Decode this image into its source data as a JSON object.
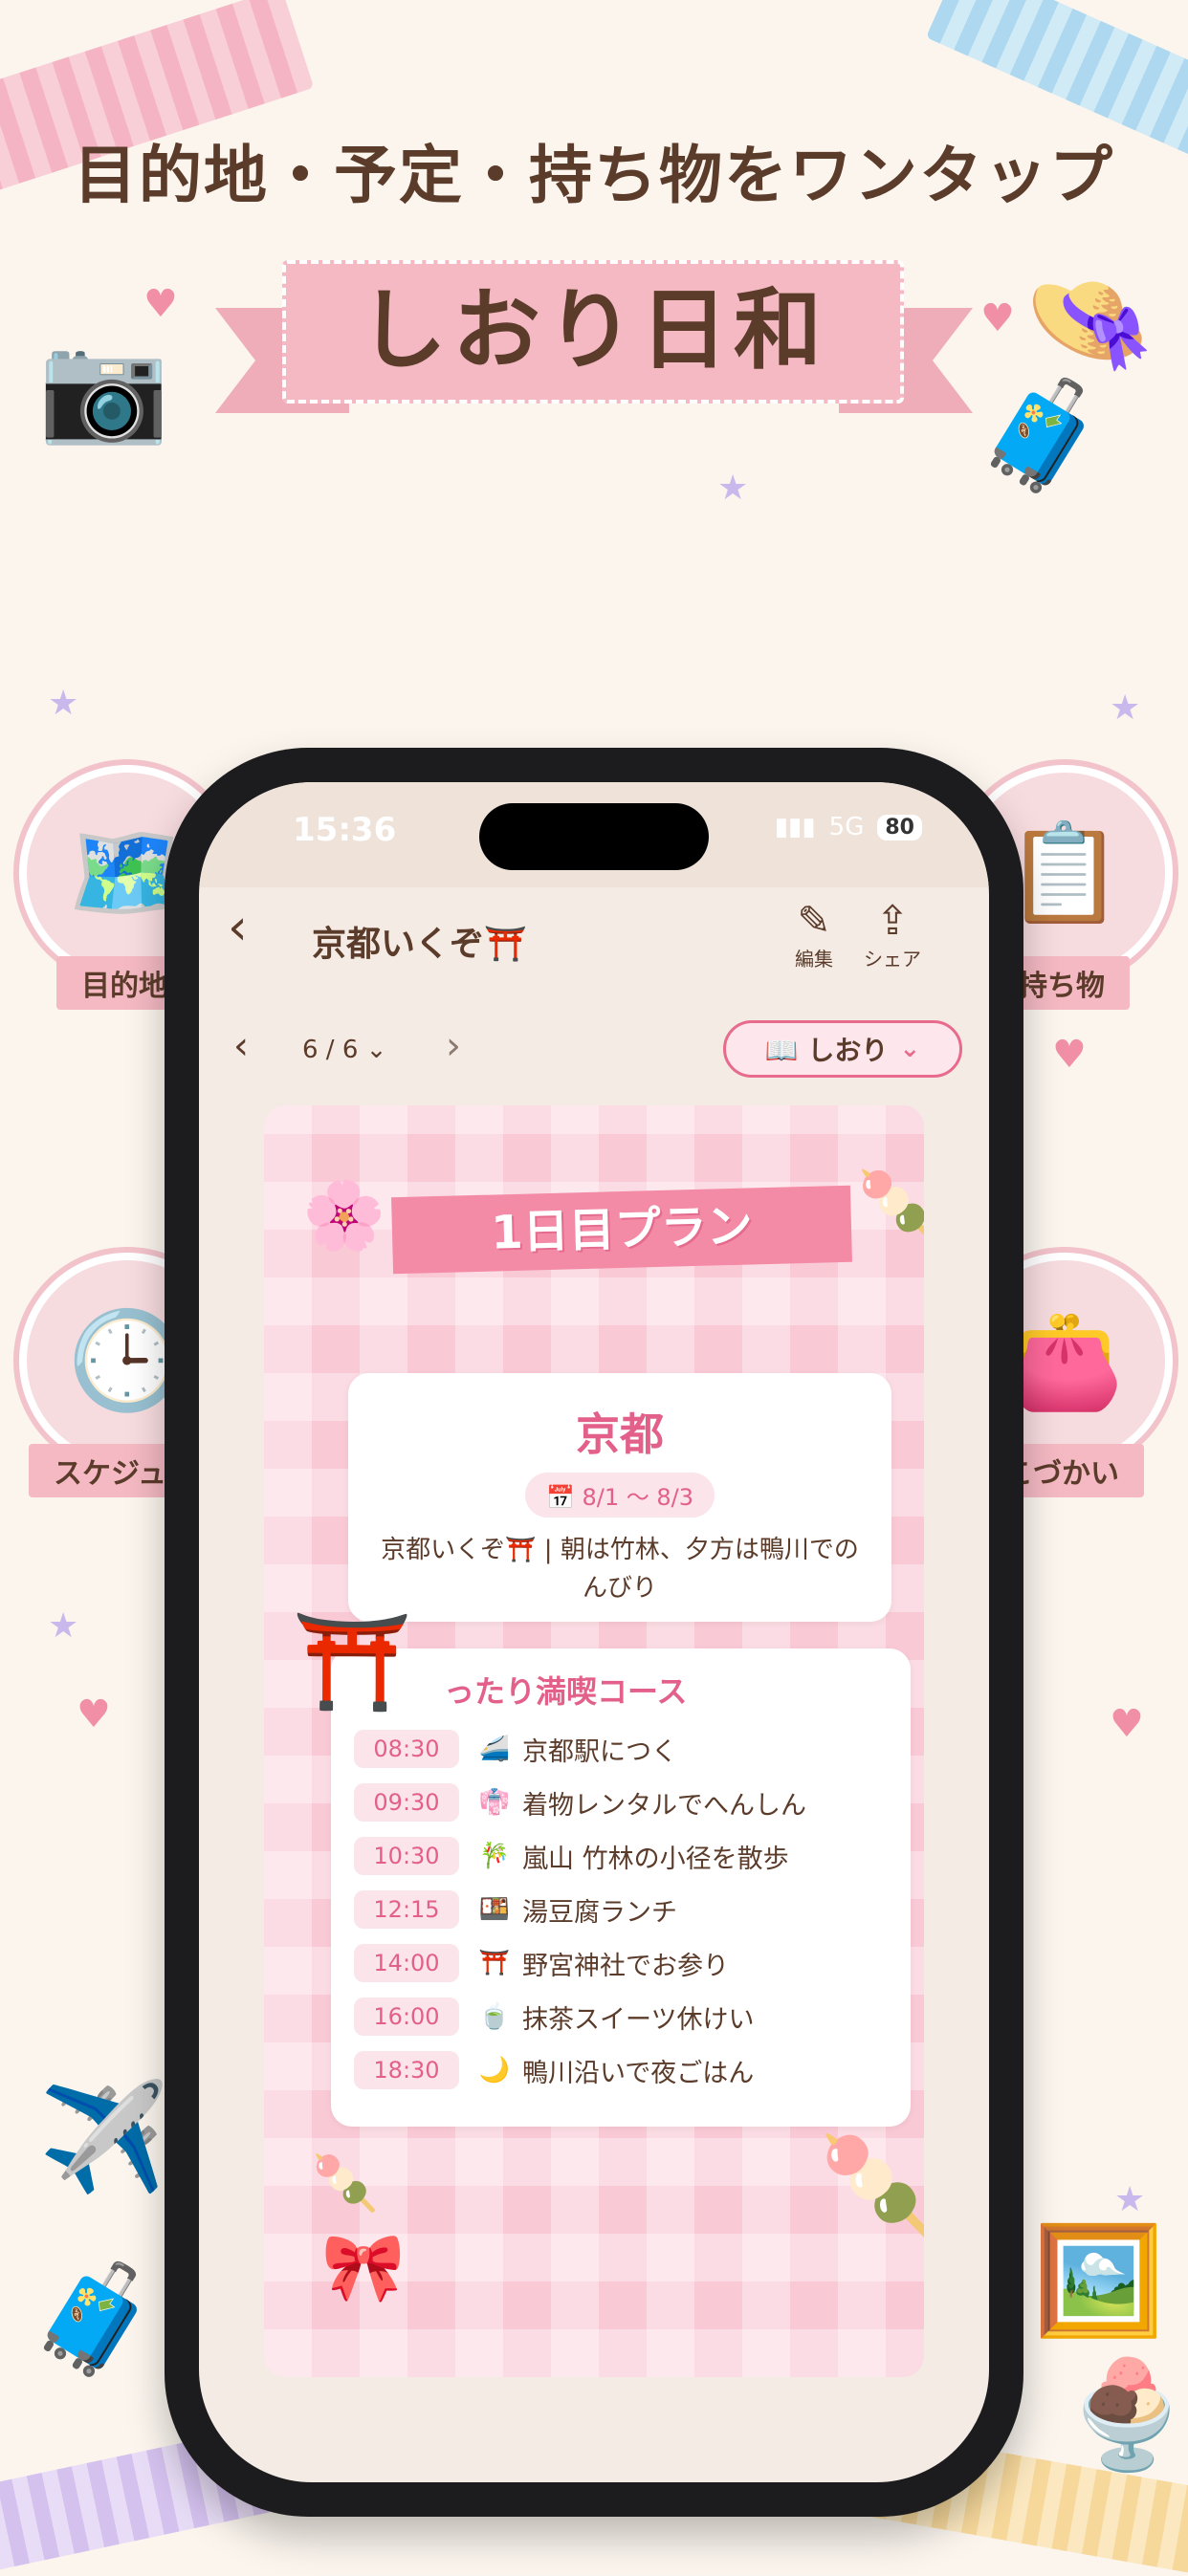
{
  "promo": {
    "headline": "目的地・予定・持ち物をワンタップ",
    "app_name": "しおり日和",
    "features": [
      "目的地",
      "持ち物",
      "スケジュー",
      "こづかい"
    ]
  },
  "status_bar": {
    "time": "15:36",
    "network": "5G",
    "battery": "80"
  },
  "nav": {
    "title": "京都いくぞ⛩️",
    "edit_label": "編集",
    "share_label": "シェア"
  },
  "pager": {
    "label": "6 / 6 ⌄",
    "mode_label": "📖 しおり"
  },
  "plan": {
    "page_title": "1日目プラン",
    "city": "京都",
    "dates": "📅 8/1 〜 8/3",
    "memo": "京都いくぞ⛩️ | 朝は竹林、夕方は鴨川でのんびり",
    "course_title": "ったり満喫コース",
    "schedule": [
      {
        "time": "08:30",
        "icon": "🚄",
        "text": "京都駅につく"
      },
      {
        "time": "09:30",
        "icon": "👘",
        "text": "着物レンタルでへんしん"
      },
      {
        "time": "10:30",
        "icon": "🎋",
        "text": "嵐山 竹林の小径を散歩"
      },
      {
        "time": "12:15",
        "icon": "🍱",
        "text": "湯豆腐ランチ"
      },
      {
        "time": "14:00",
        "icon": "⛩️",
        "text": "野宮神社でお参り"
      },
      {
        "time": "16:00",
        "icon": "🍵",
        "text": "抹茶スイーツ休けい"
      },
      {
        "time": "18:30",
        "icon": "🌙",
        "text": "鴨川沿いで夜ごはん"
      }
    ]
  }
}
